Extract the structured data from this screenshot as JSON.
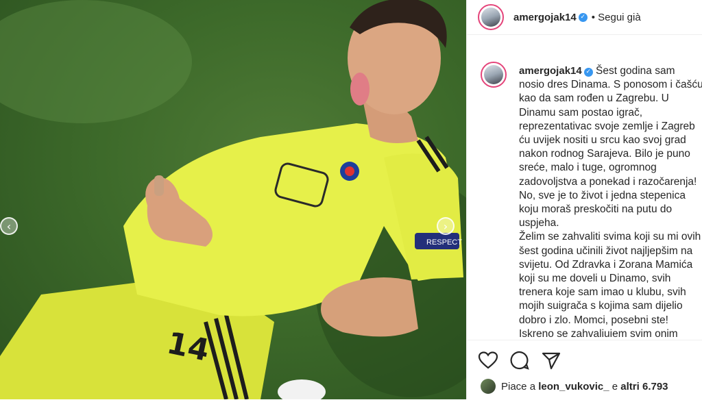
{
  "post": {
    "username": "amergojak14",
    "follow_status": "• Segui già"
  },
  "photo": {
    "jersey_number": "14",
    "sponsor_text": "RESPECT"
  },
  "caption": {
    "username": "amergojak14",
    "text": "Šest godina sam\nnosio dres Dinama. S ponosom i čašću\nkao da sam rođen u Zagrebu. U\nDinamu sam postao igrač,\nreprezentativac svoje zemlje i Zagreb\nću uvijek nositi u srcu kao svoj grad\nnakon rodnog Sarajeva. Bilo je puno\nsreće, malo i tuge, ogromnog\nzadovoljstva a ponekad i razočarenja!\nNo, sve je to život i jedna stepenica\nkoju moraš preskočiti na putu do\nuspjeha.\nŽelim se zahvaliti svima koji su mi ovih\nšest godina učinili život najljepšim na\nsvijetu. Od Zdravka i Zorana Mamića\nkoji su me doveli u Dinamo, svih\ntrenera koje sam imao u klubu, svih\nmojih suigrača s kojima sam dijelio\ndobro i zlo. Momci, posebni ste!\nIskreno se zahvaljujem svim onim"
  },
  "likes": {
    "prefix": "Piace a",
    "user": "leon_vukovic_",
    "middle": "e",
    "others": "altri 6.793"
  },
  "icons": [
    "heart-icon",
    "comment-icon",
    "share-icon",
    "chevron-left-icon",
    "chevron-right-icon",
    "verified-icon"
  ],
  "colors": {
    "verified": "#3897f0",
    "story_ring": "#e4447a",
    "jersey": "#e6f04a"
  }
}
